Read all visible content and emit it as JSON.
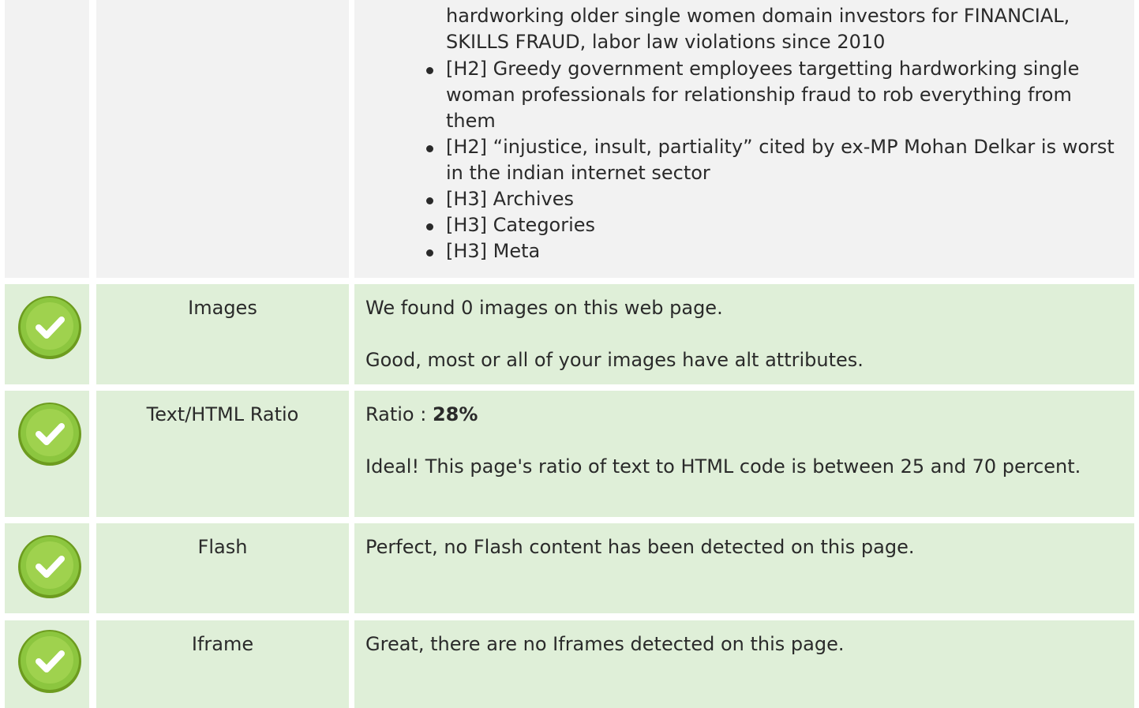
{
  "headings": {
    "continued_text": "hardworking older single women domain investors for FINANCIAL, SKILLS FRAUD, labor law violations since 2010",
    "items": [
      "[H2] Greedy government employees targetting hardworking single woman professionals for relationship fraud to rob everything from them",
      "[H2] “injustice, insult, partiality” cited by ex-MP Mohan Delkar is worst in the indian internet sector",
      "[H3] Archives",
      "[H3] Categories",
      "[H3] Meta"
    ]
  },
  "rows": [
    {
      "label": "Images",
      "status_icon": "check-circle-icon",
      "lines": [
        "We found 0 images on this web page.",
        "Good, most or all of your images have alt attributes."
      ]
    },
    {
      "label": "Text/HTML Ratio",
      "status_icon": "check-circle-icon",
      "ratio_prefix": "Ratio : ",
      "ratio_value": "28%",
      "lines": [
        "Ideal! This page's ratio of text to HTML code is between 25 and 70 percent."
      ]
    },
    {
      "label": "Flash",
      "status_icon": "check-circle-icon",
      "lines": [
        "Perfect, no Flash content has been detected on this page."
      ]
    },
    {
      "label": "Iframe",
      "status_icon": "check-circle-icon",
      "lines": [
        "Great, there are no Iframes detected on this page."
      ]
    }
  ],
  "colors": {
    "row_green": "#dfefd8",
    "row_grey": "#f2f2f2",
    "check_green": "#8cc63f"
  }
}
